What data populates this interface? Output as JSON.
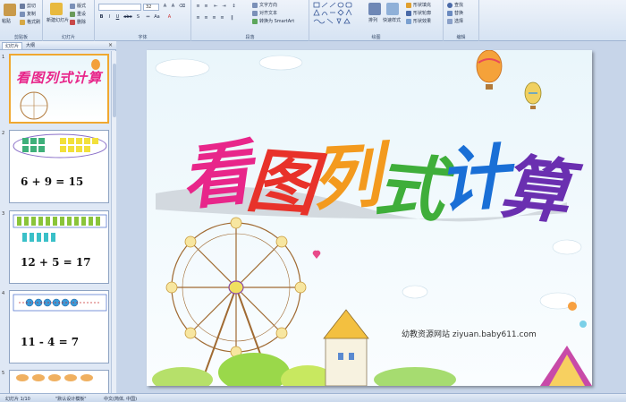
{
  "ribbon": {
    "clipboard": {
      "label": "剪贴板",
      "paste": "粘贴",
      "cut": "剪切",
      "copy": "复制",
      "format_painter": "格式刷"
    },
    "slides": {
      "label": "幻灯片",
      "new_slide": "新建幻灯片",
      "layout": "版式",
      "reset": "重设",
      "delete": "删除"
    },
    "font": {
      "label": "字体",
      "font_size": "32",
      "bold": "B",
      "italic": "I",
      "underline": "U",
      "strike": "abe",
      "shadow": "S"
    },
    "paragraph": {
      "label": "段落",
      "text_direction": "文字方向",
      "align_text": "对齐文本",
      "smartart": "转换为 SmartArt"
    },
    "drawing": {
      "label": "绘图",
      "arrange": "排列",
      "quick_styles": "快速样式",
      "shape_fill": "形状填充",
      "shape_outline": "形状轮廓",
      "shape_effects": "形状效果"
    },
    "editing": {
      "label": "编辑",
      "find": "查找",
      "replace": "替换",
      "select": "选择"
    }
  },
  "panel": {
    "tab_slides": "幻灯片",
    "tab_outline": "大纲",
    "close": "×",
    "slides": [
      {
        "num": "1",
        "title": "看图列式计算"
      },
      {
        "num": "2",
        "equation": "6 + 9 = 15"
      },
      {
        "num": "3",
        "equation": "12 + 5 = 17"
      },
      {
        "num": "4",
        "equation": "11 - 4 = 7"
      },
      {
        "num": "5"
      }
    ]
  },
  "slide": {
    "title_chars": [
      "看",
      "图",
      "列",
      "式",
      "计",
      "算"
    ],
    "watermark": "幼教资源网站 ziyuan.baby611.com",
    "colors": {
      "c1": "#e8268a",
      "c2": "#e8322a",
      "c3": "#f39a1e",
      "c4": "#3fae3a",
      "c5": "#1a6fd6",
      "c6": "#6a2fb0"
    }
  },
  "status": {
    "slide_info": "幻灯片 1/10",
    "theme": "\"默认设计模板\"",
    "language": "中文(简体, 中国)"
  }
}
